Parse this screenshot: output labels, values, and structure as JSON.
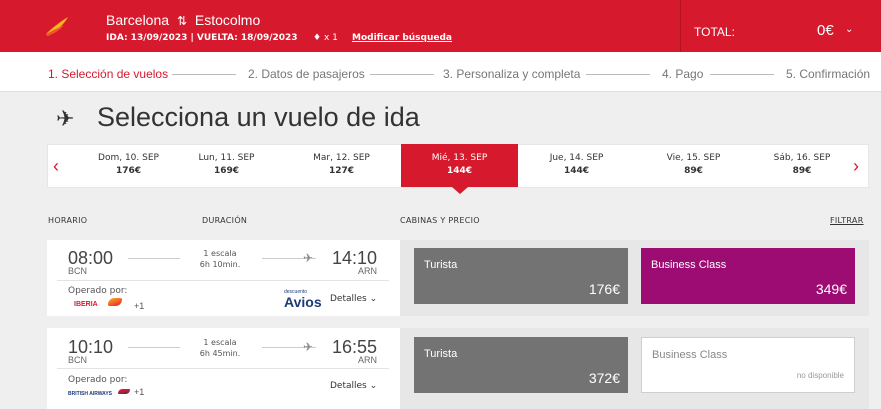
{
  "header": {
    "origin": "Barcelona",
    "swap_icon": "swap-arrows-icon",
    "destination": "Estocolmo",
    "dates": "IDA: 13/09/2023 | VUELTA: 18/09/2023",
    "pax": "x 1",
    "modify_link": "Modificar búsqueda",
    "total_label": "TOTAL:",
    "total_amount": "0€"
  },
  "steps": [
    "1. Selección de vuelos",
    "2. Datos de pasajeros",
    "3. Personaliza y completa",
    "4. Pago",
    "5. Confirmación"
  ],
  "page_title": "Selecciona un vuelo de ida",
  "dates": [
    {
      "label": "Dom, 10. SEP",
      "price": "176€"
    },
    {
      "label": "Lun, 11. SEP",
      "price": "169€"
    },
    {
      "label": "Mar, 12. SEP",
      "price": "127€"
    },
    {
      "label": "Mié, 13. SEP",
      "price": "144€"
    },
    {
      "label": "Jue, 14. SEP",
      "price": "144€"
    },
    {
      "label": "Vie, 15. SEP",
      "price": "89€"
    },
    {
      "label": "Sáb, 16. SEP",
      "price": "89€"
    }
  ],
  "columns": {
    "horario": "HORARIO",
    "duracion": "DURACIÓN",
    "cabinas": "CABINAS Y PRECIO",
    "filtrar": "FILTRAR"
  },
  "flights": [
    {
      "dep_time": "08:00",
      "dep_code": "BCN",
      "arr_time": "14:10",
      "arr_code": "ARN",
      "stops": "1 escala",
      "duration": "6h 10min.",
      "operated_label": "Operado por:",
      "airline": "IBERIA",
      "extra": "+1",
      "avios_small": "descuento",
      "avios_big": "Avios",
      "details": "Detalles",
      "turista_label": "Turista",
      "turista_price": "176€",
      "business_label": "Business Class",
      "business_price": "349€"
    },
    {
      "dep_time": "10:10",
      "dep_code": "BCN",
      "arr_time": "16:55",
      "arr_code": "ARN",
      "stops": "1 escala",
      "duration": "6h 45min.",
      "operated_label": "Operado por:",
      "airline": "BRITISH AIRWAYS",
      "extra": "+1",
      "details": "Detalles",
      "turista_label": "Turista",
      "turista_price": "372€",
      "business_label": "Business Class",
      "business_unavailable": "no disponible"
    }
  ],
  "colors": {
    "brand_red": "#d7192d",
    "turista_gray": "#737373",
    "business_purple": "#9c0c72"
  }
}
